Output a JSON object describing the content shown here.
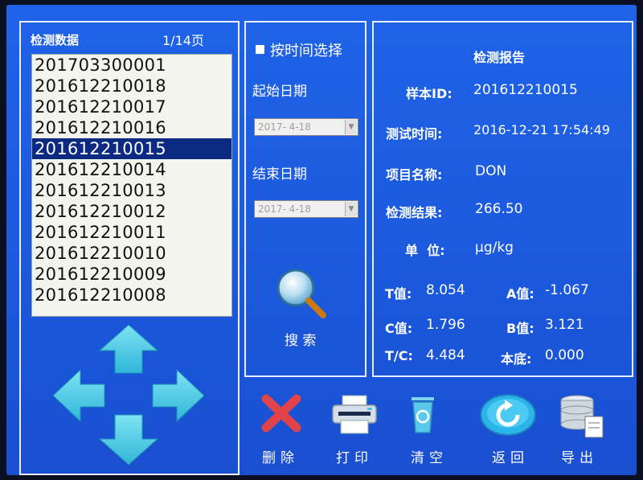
{
  "list_panel": {
    "title": "检测数据",
    "page": "1/14页",
    "items": [
      "201703300001",
      "201612210018",
      "201612210017",
      "201612210016",
      "201612210015",
      "201612210014",
      "201612210013",
      "201612210012",
      "201612210011",
      "201612210010",
      "201612210009",
      "201612210008"
    ],
    "selected_index": 4
  },
  "filter_panel": {
    "time_select_label": "按时间选择",
    "start_label": "起始日期",
    "start_value": "2017- 4-18",
    "end_label": "结束日期",
    "end_value": "2017- 4-18",
    "search_label": "搜 索"
  },
  "report": {
    "title": "检测报告",
    "sample_id_label": "样本ID:",
    "sample_id": "201612210015",
    "test_time_label": "测试时间:",
    "test_time": "2016-12-21 17:54:49",
    "item_name_label": "项目名称:",
    "item_name": "DON",
    "result_label": "检测结果:",
    "result": "266.50",
    "unit_label": "单  位:",
    "unit": "μg/kg",
    "t_label": "T值:",
    "t_value": "8.054",
    "a_label": "A值:",
    "a_value": "-1.067",
    "c_label": "C值:",
    "c_value": "1.796",
    "b_label": "B值:",
    "b_value": "3.121",
    "tc_label": "T/C:",
    "tc_value": "4.484",
    "base_label": "本底:",
    "base_value": "0.000"
  },
  "toolbar": {
    "delete": "删除",
    "print": "打印",
    "clear": "清空",
    "back": "返回",
    "export": "导出"
  }
}
